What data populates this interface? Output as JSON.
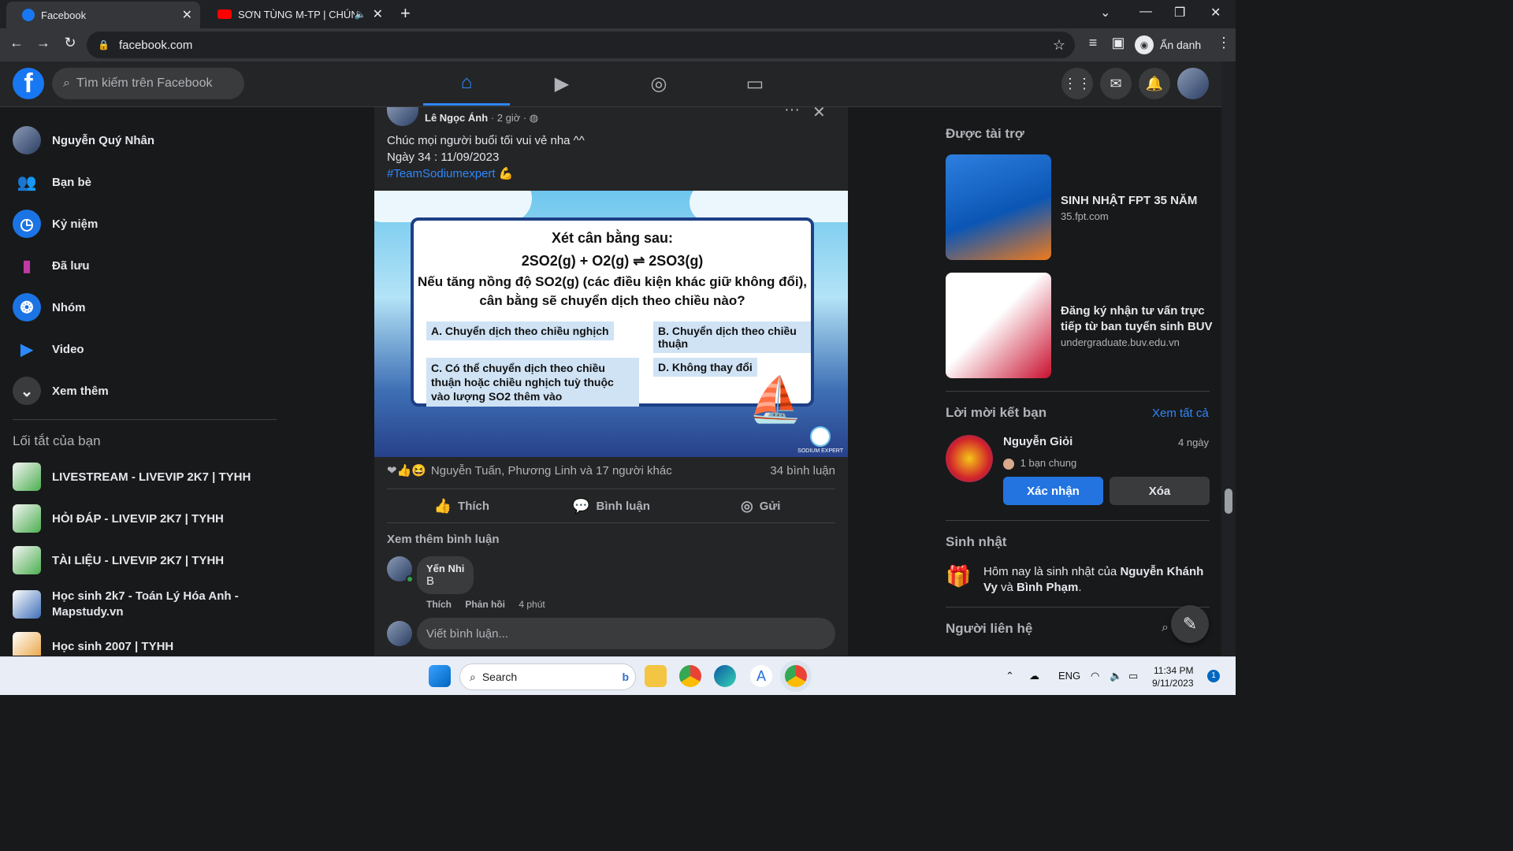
{
  "browser": {
    "tabs": [
      {
        "title": "Facebook",
        "icon": "facebook-icon"
      },
      {
        "title": "SƠN TÙNG M-TP | CHÚNG T",
        "icon": "youtube-icon"
      }
    ],
    "url": "facebook.com",
    "incognito_label": "Ẩn danh"
  },
  "fb_header": {
    "search_placeholder": "Tìm kiếm trên Facebook",
    "accent": "#2d88ff"
  },
  "left_nav": {
    "profile_name": "Nguyễn Quý Nhân",
    "items": [
      {
        "label": "Bạn bè",
        "icon": "friends-icon"
      },
      {
        "label": "Kỷ niệm",
        "icon": "memories-icon"
      },
      {
        "label": "Đã lưu",
        "icon": "saved-icon"
      },
      {
        "label": "Nhóm",
        "icon": "groups-icon"
      },
      {
        "label": "Video",
        "icon": "video-icon"
      },
      {
        "label": "Xem thêm",
        "icon": "chevron-down-icon"
      }
    ],
    "shortcuts_title": "Lối tắt của bạn",
    "shortcuts": [
      "LIVESTREAM - LIVEVIP 2K7 | TYHH",
      "HỎI ĐÁP - LIVEVIP 2K7 | TYHH",
      "TÀI LIỆU - LIVEVIP 2K7 | TYHH",
      "Học sinh 2k7 - Toán Lý Hóa Anh - Mapstudy.vn",
      "Học sinh 2007 | TYHH"
    ]
  },
  "post": {
    "author": "Lê Ngọc Ánh",
    "time": "· 2 giờ ·",
    "text_line1": "Chúc mọi người buổi tối vui vẻ nha ^^",
    "text_line2": "Ngày 34 : 11/09/2023",
    "hashtag": "#TeamSodiumexpert",
    "image": {
      "title": "Xét cân bằng sau:",
      "equation": "2SO2(g) + O2(g) ⇌ 2SO3(g)",
      "question1": "Nếu tăng nồng độ SO2(g) (các điều kiện khác giữ không đổi),",
      "question2": "cân bằng sẽ chuyển dịch theo chiều nào?",
      "option_a": "A. Chuyển dịch theo chiều nghịch",
      "option_b": "B. Chuyển dịch theo chiều thuận",
      "option_c": "C. Có thể chuyển dịch theo chiều thuận hoặc chiều nghịch tuỳ thuộc vào lượng SO2 thêm vào",
      "option_d": "D. Không thay đổi",
      "watermark": "SODIUM EXPERT"
    },
    "reactions_text": "Nguyễn Tuấn, Phương Linh và 17 người khác",
    "comments_count": "34 bình luận",
    "actions": {
      "like": "Thích",
      "comment": "Bình luận",
      "share": "Gửi"
    },
    "more_comments": "Xem thêm bình luận",
    "comment": {
      "name": "Yến Nhi",
      "text": "B",
      "like": "Thích",
      "reply": "Phản hồi",
      "time": "4 phút"
    },
    "write_placeholder": "Viết bình luận..."
  },
  "right_col": {
    "sponsored_title": "Được tài trợ",
    "ads": [
      {
        "title": "SINH NHẬT FPT 35 NĂM",
        "url": "35.fpt.com"
      },
      {
        "title": "Đăng ký nhận tư vấn trực tiếp từ ban tuyển sinh BUV",
        "url": "undergraduate.buv.edu.vn"
      }
    ],
    "friend_requests_title": "Lời mời kết bạn",
    "see_all": "Xem tất cả",
    "friend": {
      "name": "Nguyễn Giỏi",
      "time": "4 ngày",
      "mutual": "1 bạn chung",
      "confirm": "Xác nhận",
      "delete": "Xóa"
    },
    "birthday_title": "Sinh nhật",
    "birthday_prefix": "Hôm nay là sinh nhật của ",
    "birthday_name1": "Nguyễn Khánh Vy",
    "birthday_and": " và ",
    "birthday_name2": "Bình Phạm",
    "birthday_suffix": ".",
    "contacts_title": "Người liên hệ"
  },
  "taskbar": {
    "search_label": "Search",
    "lang": "ENG",
    "time": "11:34 PM",
    "date": "9/11/2023",
    "notif_count": "1"
  }
}
